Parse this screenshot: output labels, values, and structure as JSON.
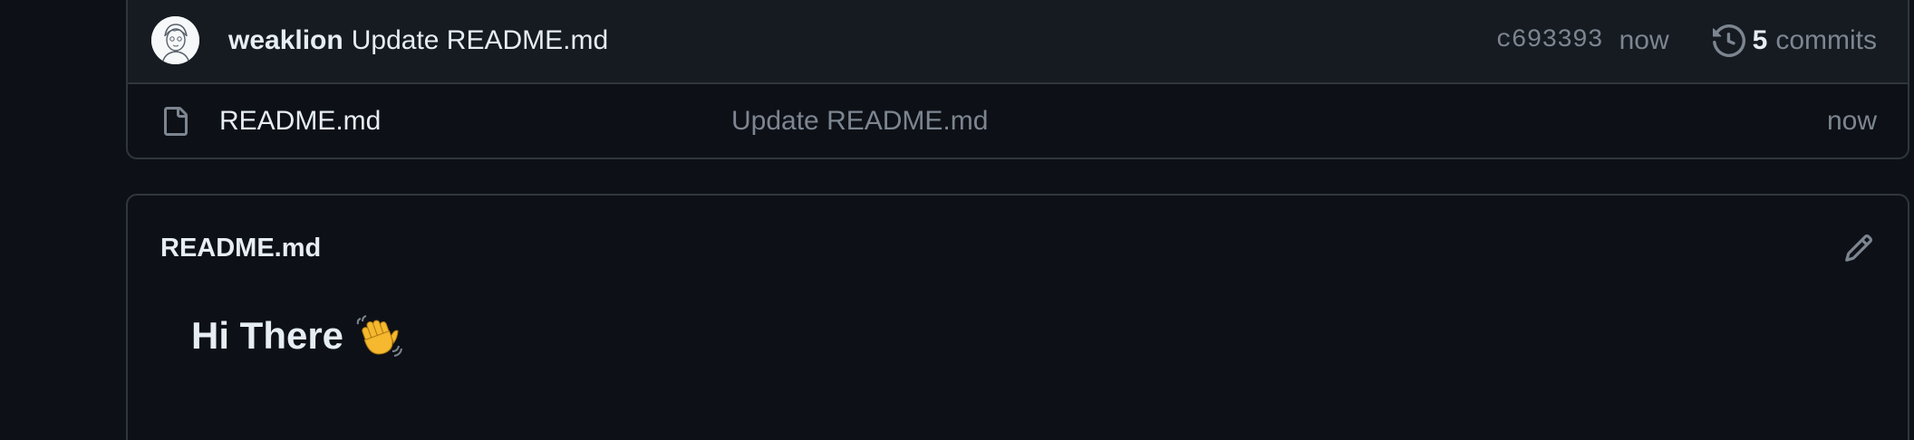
{
  "latest_commit": {
    "author": "weaklion",
    "message": "Update README.md",
    "sha": "c693393",
    "time": "now",
    "commits_count": "5",
    "commits_label": "commits",
    "history_icon": "history-icon"
  },
  "files": [
    {
      "icon": "file-icon",
      "name": "README.md",
      "commit_message": "Update README.md",
      "time": "now"
    }
  ],
  "readme": {
    "title": "README.md",
    "edit_icon": "pencil-icon",
    "heading": "Hi There",
    "heading_emoji": "waving-hand-icon"
  },
  "colors": {
    "background": "#0d1117",
    "header_row": "#161b22",
    "border": "#30363d",
    "text_primary": "#e6edf3",
    "text_muted": "#7d8590"
  }
}
